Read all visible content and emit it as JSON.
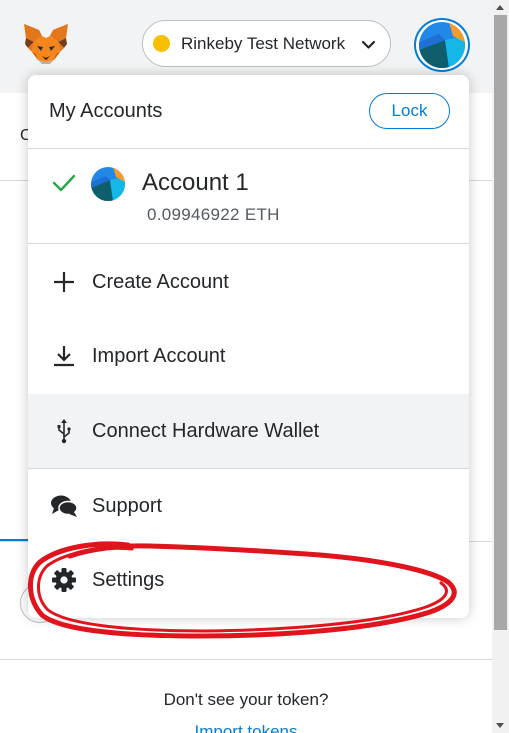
{
  "header": {
    "network": {
      "label": "Rinkeby Test Network",
      "status_color": "#f8c000"
    },
    "logo_icon": "metamask-fox-icon",
    "avatar_icon": "account-identicon"
  },
  "account_menu": {
    "title": "My Accounts",
    "lock_label": "Lock",
    "accounts": [
      {
        "name": "Account 1",
        "balance": "0.09946922 ETH",
        "selected": true
      }
    ],
    "items": [
      {
        "label": "Create Account",
        "icon": "plus-icon"
      },
      {
        "label": "Import Account",
        "icon": "download-icon"
      },
      {
        "label": "Connect Hardware Wallet",
        "icon": "usb-icon"
      },
      {
        "label": "Support",
        "icon": "chat-bubbles-icon"
      },
      {
        "label": "Settings",
        "icon": "gear-icon"
      }
    ]
  },
  "background": {
    "sliver_text": "C",
    "no_token_text": "Don't see your token?",
    "import_tokens_link": "Import tokens"
  },
  "colors": {
    "accent": "#037dd6",
    "check": "#28a745",
    "annotation": "#e0141c"
  }
}
